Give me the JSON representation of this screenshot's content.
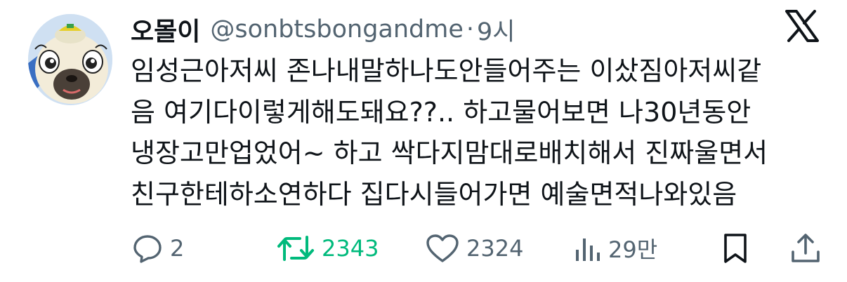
{
  "tweet": {
    "display_name": "오몰이",
    "handle": "@sonbtsbongandme",
    "separator": "·",
    "time": "9시",
    "body_lines": [
      "임성근아저씨 존나내말하나도안들어주는 이샀짐아저씨같",
      "음 여기다이렇게해도돼요??.. 하고물어보면 나30년동안",
      "냉장고만업었어~ 하고 싹다지맘대로배치해서 진짜울면서",
      "친구한테하소연하다 집다시들어가면 예술면적나와있음"
    ]
  },
  "actions": {
    "replies": "2",
    "reposts": "2343",
    "likes": "2324",
    "views": "29만"
  },
  "icons": {
    "reply": "reply-icon",
    "repost": "repost-icon",
    "like": "heart-icon",
    "views": "views-icon",
    "bookmark": "bookmark-icon",
    "share": "share-icon",
    "platform": "x-logo-icon"
  },
  "colors": {
    "text": "#0f1419",
    "secondary": "#536471",
    "repost_active": "#00ba7c"
  }
}
